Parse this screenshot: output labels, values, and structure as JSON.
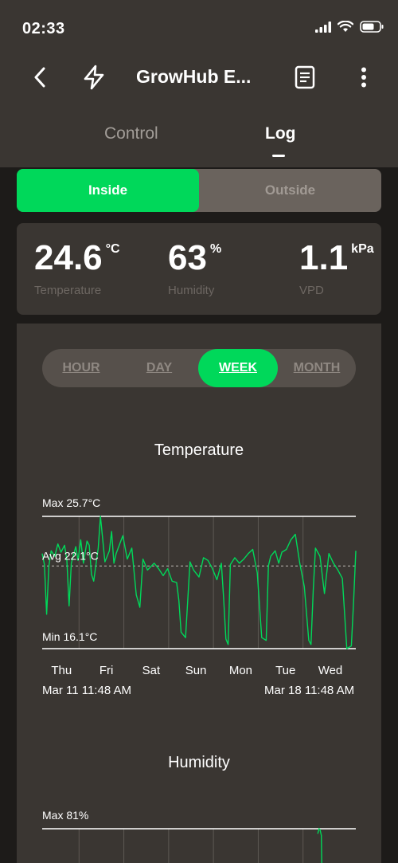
{
  "status_bar": {
    "time": "02:33"
  },
  "header": {
    "title": "GrowHub E...",
    "tabs": [
      {
        "label": "Control",
        "active": false
      },
      {
        "label": "Log",
        "active": true
      }
    ]
  },
  "location_toggle": {
    "options": [
      "Inside",
      "Outside"
    ],
    "selected": "Inside"
  },
  "readings": [
    {
      "value": "24.6",
      "unit": "°C",
      "label": "Temperature"
    },
    {
      "value": "63",
      "unit": "%",
      "label": "Humidity"
    },
    {
      "value": "1.1",
      "unit": "kPa",
      "label": "VPD"
    }
  ],
  "time_range": {
    "options": [
      "HOUR",
      "DAY",
      "WEEK",
      "MONTH"
    ],
    "selected": "WEEK"
  },
  "colors": {
    "accent": "#00d85a",
    "panel": "#3a3632",
    "background": "#1d1b19"
  },
  "chart_data": [
    {
      "type": "line",
      "title": "Temperature",
      "max_label": "Max 25.7°C",
      "avg_label": "Avg 22.1°C",
      "min_label": "Min 16.1°C",
      "ylim": [
        16.1,
        25.7
      ],
      "avg": 22.1,
      "x_ticks": [
        "Thu",
        "Fri",
        "Sat",
        "Sun",
        "Mon",
        "Tue",
        "Wed"
      ],
      "start_label": "Mar 11 11:48 AM",
      "end_label": "Mar 18 11:48 AM",
      "xlim": [
        0,
        7
      ],
      "series": [
        {
          "x": [
            0,
            0.05,
            0.1,
            0.15,
            0.2,
            0.28,
            0.35,
            0.42,
            0.5,
            0.55,
            0.6,
            0.65,
            0.75,
            0.8,
            0.86,
            0.92,
            1.0,
            1.05,
            1.1,
            1.15,
            1.25,
            1.3,
            1.4,
            1.5,
            1.55,
            1.6,
            1.65,
            1.72,
            1.8,
            1.9,
            2.0,
            2.05,
            2.1,
            2.18,
            2.25,
            2.35,
            2.5,
            2.6,
            2.7,
            2.8,
            2.9,
            3.0,
            3.05,
            3.1,
            3.2,
            3.3,
            3.38,
            3.5,
            3.6,
            3.7,
            3.8,
            3.9,
            4.0,
            4.05,
            4.1,
            4.15,
            4.2,
            4.3,
            4.4,
            4.5,
            4.6,
            4.7,
            4.8,
            4.9,
            5.0,
            5.05,
            5.1,
            5.2,
            5.28,
            5.35,
            5.45,
            5.55,
            5.65,
            5.75,
            5.85,
            5.95,
            6.0,
            6.05,
            6.1,
            6.2,
            6.3,
            6.4,
            6.5,
            6.6,
            6.7,
            6.8,
            6.9,
            6.95,
            7.0
          ],
          "values": [
            23.0,
            22.2,
            18.6,
            22.1,
            23.2,
            22.8,
            23.7,
            23.1,
            23.6,
            22.5,
            19.2,
            22.3,
            23.5,
            22.5,
            24.0,
            22.3,
            23.9,
            23.6,
            21.5,
            21.0,
            23.4,
            25.7,
            22.4,
            23.2,
            24.6,
            22.3,
            23.0,
            23.6,
            24.3,
            22.6,
            23.4,
            21.7,
            20.0,
            19.1,
            22.6,
            21.8,
            22.3,
            21.9,
            21.4,
            21.9,
            21.0,
            20.9,
            19.6,
            17.3,
            16.9,
            22.4,
            21.8,
            21.3,
            22.7,
            22.5,
            21.9,
            21.1,
            22.3,
            19.7,
            16.8,
            16.4,
            22.2,
            22.7,
            22.3,
            22.6,
            23.0,
            23.3,
            21.6,
            16.9,
            16.7,
            22.1,
            22.8,
            23.2,
            22.3,
            23.1,
            23.3,
            24.0,
            24.4,
            22.3,
            20.6,
            16.7,
            16.4,
            20.3,
            23.4,
            22.8,
            20.1,
            23.0,
            22.3,
            21.8,
            21.2,
            16.1,
            16.3,
            19.5,
            23.2
          ]
        }
      ]
    },
    {
      "type": "line",
      "title": "Humidity",
      "max_label": "Max 81%",
      "ylim": [
        0,
        81
      ],
      "xlim": [
        0,
        7
      ],
      "series": [
        {
          "x": [
            6.15,
            6.18,
            6.2,
            6.23
          ],
          "values": [
            78,
            81,
            80.5,
            77
          ]
        }
      ]
    }
  ]
}
